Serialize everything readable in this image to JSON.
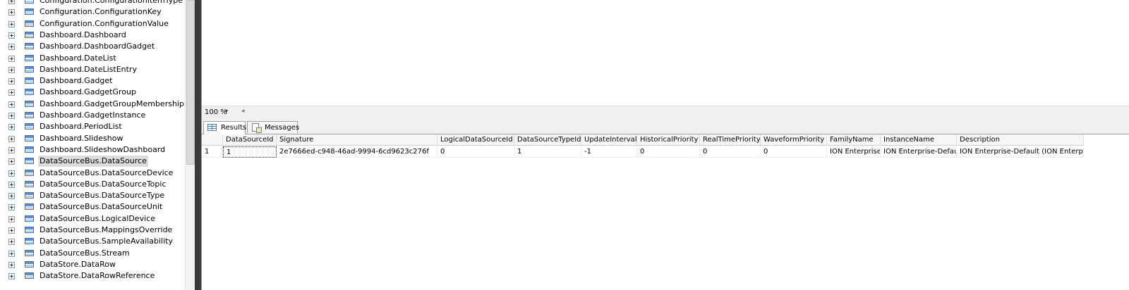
{
  "explorer": {
    "items": [
      {
        "label": "Configuration.ConfigurationItemType",
        "selected": false
      },
      {
        "label": "Configuration.ConfigurationKey",
        "selected": false
      },
      {
        "label": "Configuration.ConfigurationValue",
        "selected": false
      },
      {
        "label": "Dashboard.Dashboard",
        "selected": false
      },
      {
        "label": "Dashboard.DashboardGadget",
        "selected": false
      },
      {
        "label": "Dashboard.DateList",
        "selected": false
      },
      {
        "label": "Dashboard.DateListEntry",
        "selected": false
      },
      {
        "label": "Dashboard.Gadget",
        "selected": false
      },
      {
        "label": "Dashboard.GadgetGroup",
        "selected": false
      },
      {
        "label": "Dashboard.GadgetGroupMembership",
        "selected": false
      },
      {
        "label": "Dashboard.GadgetInstance",
        "selected": false
      },
      {
        "label": "Dashboard.PeriodList",
        "selected": false
      },
      {
        "label": "Dashboard.Slideshow",
        "selected": false
      },
      {
        "label": "Dashboard.SlideshowDashboard",
        "selected": false
      },
      {
        "label": "DataSourceBus.DataSource",
        "selected": true
      },
      {
        "label": "DataSourceBus.DataSourceDevice",
        "selected": false
      },
      {
        "label": "DataSourceBus.DataSourceTopic",
        "selected": false
      },
      {
        "label": "DataSourceBus.DataSourceType",
        "selected": false
      },
      {
        "label": "DataSourceBus.DataSourceUnit",
        "selected": false
      },
      {
        "label": "DataSourceBus.LogicalDevice",
        "selected": false
      },
      {
        "label": "DataSourceBus.MappingsOverride",
        "selected": false
      },
      {
        "label": "DataSourceBus.SampleAvailability",
        "selected": false
      },
      {
        "label": "DataSourceBus.Stream",
        "selected": false
      },
      {
        "label": "DataStore.DataRow",
        "selected": false
      },
      {
        "label": "DataStore.DataRowReference",
        "selected": false
      }
    ]
  },
  "zoom": {
    "value": "100 %",
    "dropdown_glyph": "▾",
    "scroll_glyph": "◂"
  },
  "tabs": {
    "results": "Results",
    "messages": "Messages"
  },
  "grid": {
    "columns": [
      "DataSourceId",
      "Signature",
      "LogicalDataSourceId",
      "DataSourceTypeId",
      "UpdateInterval",
      "HistoricalPriority",
      "RealTimePriority",
      "WaveformPriority",
      "FamilyName",
      "InstanceName",
      "Description"
    ],
    "rows": [
      {
        "num": "1",
        "cells": [
          "1",
          "2e7666ed-c948-46ad-9994-6cd9623c276f",
          "0",
          "1",
          "-1",
          "0",
          "0",
          "0",
          "ION Enterprise",
          "ION Enterprise-Default",
          "ION Enterprise-Default (ION Enterprise)"
        ]
      }
    ]
  }
}
